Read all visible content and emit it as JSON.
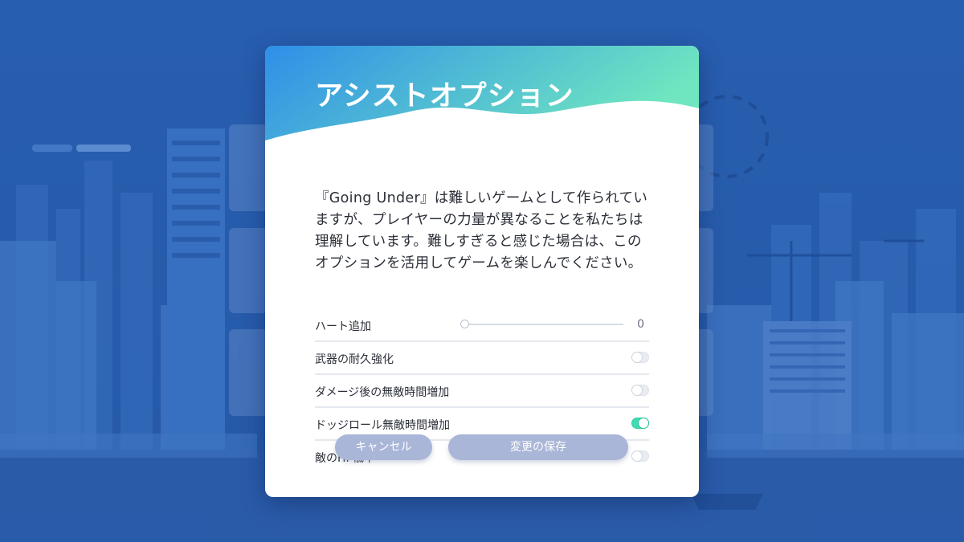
{
  "dialog": {
    "title": "アシストオプション",
    "description_lines": [
      "『Going Under』は難しいゲームとして作られてい",
      "ますが、プレイヤーの力量が異なることを私たちは",
      "理解しています。難しすぎると感じた場合は、この",
      "オプションを活用してゲームを楽しんでください。"
    ],
    "options": [
      {
        "label": "ハート追加",
        "control": "slider",
        "value": "0",
        "slider_fraction": 0
      },
      {
        "label": "武器の耐久強化",
        "control": "toggle",
        "on": false
      },
      {
        "label": "ダメージ後の無敵時間増加",
        "control": "toggle",
        "on": false
      },
      {
        "label": "ドッジロール無敵時間増加",
        "control": "toggle",
        "on": true
      },
      {
        "label": "敵のHP低下",
        "control": "toggle",
        "on": false
      }
    ],
    "buttons": {
      "cancel": "キャンセル",
      "save": "変更の保存"
    }
  },
  "colors": {
    "background": "#2a63b4",
    "header_gradient_start": "#2f8ee8",
    "header_gradient_end": "#6fe6c0",
    "toggle_on": "#3fdcb2",
    "button": "#aab6d8"
  }
}
